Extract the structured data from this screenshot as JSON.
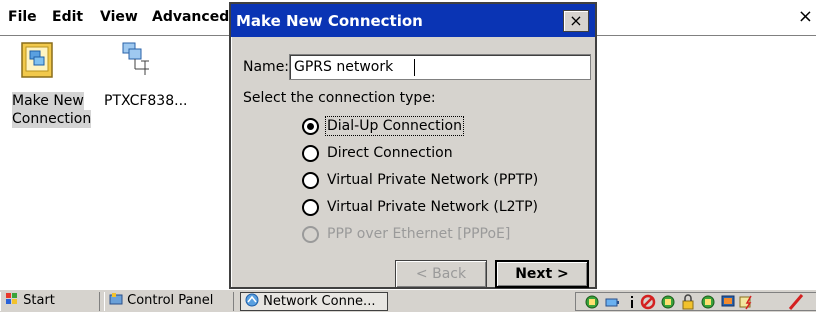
{
  "menu": {
    "file": "File",
    "edit": "Edit",
    "view": "View",
    "advanced": "Advanced",
    "close": "×"
  },
  "icons": [
    {
      "label_line1": "Make New",
      "label_line2": "Connection",
      "icon": "make-new-connection-icon"
    },
    {
      "label_line1": "PTXCF838...",
      "icon": "network-connection-icon"
    }
  ],
  "dialog": {
    "title": "Make New Connection",
    "close": "×",
    "name_label": "Name:",
    "name_value": "GPRS network",
    "select_label": "Select the connection type:",
    "options": [
      {
        "label": "Dial-Up Connection",
        "checked": true,
        "enabled": true
      },
      {
        "label": "Direct Connection",
        "checked": false,
        "enabled": true
      },
      {
        "label": "Virtual Private Network (PPTP)",
        "checked": false,
        "enabled": true
      },
      {
        "label": "Virtual Private Network (L2TP)",
        "checked": false,
        "enabled": true
      },
      {
        "label": "PPP over Ethernet [PPPoE]",
        "checked": false,
        "enabled": false
      }
    ],
    "back_button": "< Back",
    "next_button": "Next >"
  },
  "taskbar": {
    "start": "Start",
    "control_panel": "Control Panel",
    "network_connections": "Network Conne..."
  },
  "colors": {
    "title_bar": "#0a34b4",
    "dialog_face": "#d6d3ce",
    "disabled_text": "#9a9a9a"
  }
}
